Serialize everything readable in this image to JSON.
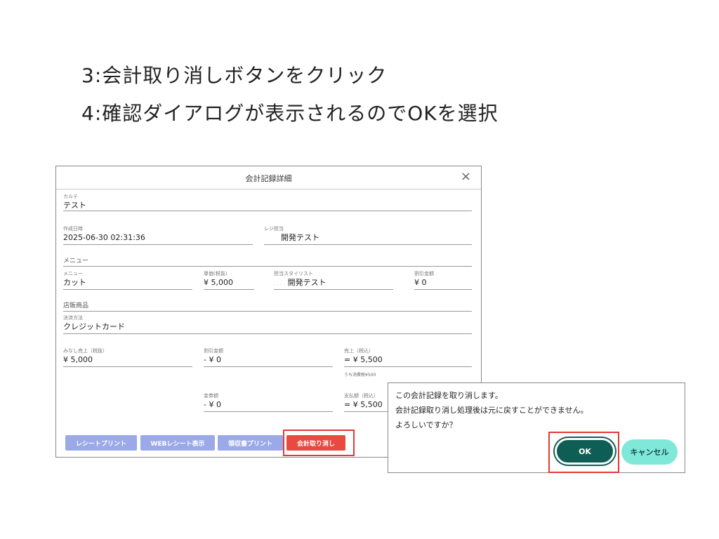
{
  "instructions": {
    "step3": "3:会計取り消しボタンをクリック",
    "step4": "4:確認ダイアログが表示されるのでOKを選択"
  },
  "record_dialog": {
    "title": "会計記録詳細",
    "close_icon": "×",
    "karte": {
      "label": "カルテ",
      "value": "テスト"
    },
    "created_at": {
      "label": "作成日時",
      "value": "2025-06-30 02:31:36"
    },
    "register_staff": {
      "label": "レジ担当",
      "value": "開発テスト"
    },
    "menu_section_label": "メニュー",
    "menu_line": {
      "menu_label": "メニュー",
      "menu_value": "カット",
      "unit_price_label": "単価(税抜)",
      "unit_price_value": "¥ 5,000",
      "stylist_label": "担当スタイリスト",
      "stylist_value": "開発テスト",
      "discount_label": "割引金額",
      "discount_value": "¥ 0"
    },
    "products_label": "店販商品",
    "payment": {
      "label": "決済方法",
      "value": "クレジットカード"
    },
    "deemed_sales": {
      "label": "みなし売上（税抜）",
      "value": "¥ 5,000"
    },
    "total_discount": {
      "label": "割引金額",
      "value": "- ¥ 0"
    },
    "sales_incl_tax": {
      "label": "売上（税込）",
      "value": "= ¥ 5,500"
    },
    "tax_note": "うち消費税¥500",
    "voucher": {
      "label": "金券額",
      "value": "- ¥ 0"
    },
    "paid": {
      "label": "支払額（税込）",
      "value": "= ¥ 5,500"
    },
    "buttons": {
      "receipt_print": "レシートプリント",
      "web_receipt": "WEBレシート表示",
      "invoice_print": "領収書プリント",
      "cancel_accounting": "会計取り消し"
    }
  },
  "confirm_dialog": {
    "line1": "この会計記録を取り消します。",
    "line2": "会計記録取り消し処理後は元に戻すことができません。",
    "line3": "よろしいですか？",
    "ok_label": "OK",
    "cancel_label": "キャンセル"
  },
  "colors": {
    "highlight": "#e53935",
    "button_purple": "#9ba9e8",
    "button_red": "#e84a3f",
    "ok_green": "#0f5e55",
    "cancel_mint": "#7fe8d8"
  }
}
